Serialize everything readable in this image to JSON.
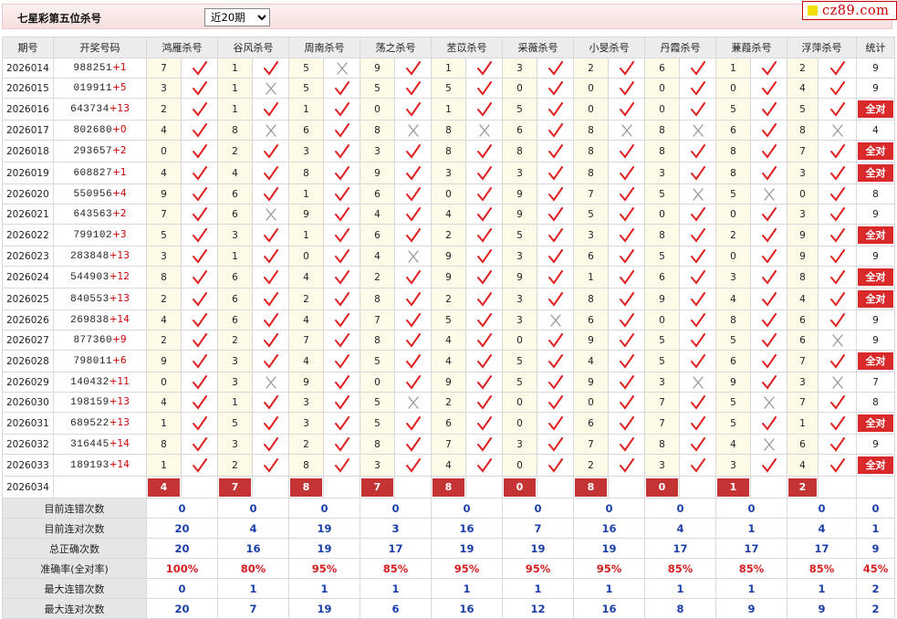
{
  "header": {
    "title": "七星彩第五位杀号",
    "period_selected": "近20期",
    "logo_text": "cz89.com"
  },
  "columns": [
    "期号",
    "开奖号码",
    "鸿雁杀号",
    "谷风杀号",
    "周南杀号",
    "荡之杀号",
    "苤苡杀号",
    "采薇杀号",
    "小旻杀号",
    "丹霞杀号",
    "蒹葭杀号",
    "浮萍杀号",
    "统计"
  ],
  "rows": [
    {
      "period": "2026014",
      "digits": "988251",
      "add": "+1",
      "picks": [
        {
          "v": "7",
          "ok": true
        },
        {
          "v": "1",
          "ok": true
        },
        {
          "v": "5",
          "ok": false
        },
        {
          "v": "9",
          "ok": true
        },
        {
          "v": "1",
          "ok": true
        },
        {
          "v": "3",
          "ok": true
        },
        {
          "v": "2",
          "ok": true
        },
        {
          "v": "6",
          "ok": true
        },
        {
          "v": "1",
          "ok": true
        },
        {
          "v": "2",
          "ok": true
        }
      ],
      "stat": "9"
    },
    {
      "period": "2026015",
      "digits": "019911",
      "add": "+5",
      "picks": [
        {
          "v": "3",
          "ok": true
        },
        {
          "v": "1",
          "ok": false
        },
        {
          "v": "5",
          "ok": true
        },
        {
          "v": "5",
          "ok": true
        },
        {
          "v": "5",
          "ok": true
        },
        {
          "v": "0",
          "ok": true
        },
        {
          "v": "0",
          "ok": true
        },
        {
          "v": "0",
          "ok": true
        },
        {
          "v": "0",
          "ok": true
        },
        {
          "v": "4",
          "ok": true
        }
      ],
      "stat": "9"
    },
    {
      "period": "2026016",
      "digits": "643734",
      "add": "+13",
      "picks": [
        {
          "v": "2",
          "ok": true
        },
        {
          "v": "1",
          "ok": true
        },
        {
          "v": "1",
          "ok": true
        },
        {
          "v": "0",
          "ok": true
        },
        {
          "v": "1",
          "ok": true
        },
        {
          "v": "5",
          "ok": true
        },
        {
          "v": "0",
          "ok": true
        },
        {
          "v": "0",
          "ok": true
        },
        {
          "v": "5",
          "ok": true
        },
        {
          "v": "5",
          "ok": true
        }
      ],
      "stat": "全对"
    },
    {
      "period": "2026017",
      "digits": "802680",
      "add": "+0",
      "picks": [
        {
          "v": "4",
          "ok": true
        },
        {
          "v": "8",
          "ok": false
        },
        {
          "v": "6",
          "ok": true
        },
        {
          "v": "8",
          "ok": false
        },
        {
          "v": "8",
          "ok": false
        },
        {
          "v": "6",
          "ok": true
        },
        {
          "v": "8",
          "ok": false
        },
        {
          "v": "8",
          "ok": false
        },
        {
          "v": "6",
          "ok": true
        },
        {
          "v": "8",
          "ok": false
        }
      ],
      "stat": "4"
    },
    {
      "period": "2026018",
      "digits": "293657",
      "add": "+2",
      "picks": [
        {
          "v": "0",
          "ok": true
        },
        {
          "v": "2",
          "ok": true
        },
        {
          "v": "3",
          "ok": true
        },
        {
          "v": "3",
          "ok": true
        },
        {
          "v": "8",
          "ok": true
        },
        {
          "v": "8",
          "ok": true
        },
        {
          "v": "8",
          "ok": true
        },
        {
          "v": "8",
          "ok": true
        },
        {
          "v": "8",
          "ok": true
        },
        {
          "v": "7",
          "ok": true
        }
      ],
      "stat": "全对"
    },
    {
      "period": "2026019",
      "digits": "608827",
      "add": "+1",
      "picks": [
        {
          "v": "4",
          "ok": true
        },
        {
          "v": "4",
          "ok": true
        },
        {
          "v": "8",
          "ok": true
        },
        {
          "v": "9",
          "ok": true
        },
        {
          "v": "3",
          "ok": true
        },
        {
          "v": "3",
          "ok": true
        },
        {
          "v": "8",
          "ok": true
        },
        {
          "v": "3",
          "ok": true
        },
        {
          "v": "8",
          "ok": true
        },
        {
          "v": "3",
          "ok": true
        }
      ],
      "stat": "全对"
    },
    {
      "period": "2026020",
      "digits": "550956",
      "add": "+4",
      "picks": [
        {
          "v": "9",
          "ok": true
        },
        {
          "v": "6",
          "ok": true
        },
        {
          "v": "1",
          "ok": true
        },
        {
          "v": "6",
          "ok": true
        },
        {
          "v": "0",
          "ok": true
        },
        {
          "v": "9",
          "ok": true
        },
        {
          "v": "7",
          "ok": true
        },
        {
          "v": "5",
          "ok": false
        },
        {
          "v": "5",
          "ok": false
        },
        {
          "v": "0",
          "ok": true
        }
      ],
      "stat": "8"
    },
    {
      "period": "2026021",
      "digits": "643563",
      "add": "+2",
      "picks": [
        {
          "v": "7",
          "ok": true
        },
        {
          "v": "6",
          "ok": false
        },
        {
          "v": "9",
          "ok": true
        },
        {
          "v": "4",
          "ok": true
        },
        {
          "v": "4",
          "ok": true
        },
        {
          "v": "9",
          "ok": true
        },
        {
          "v": "5",
          "ok": true
        },
        {
          "v": "0",
          "ok": true
        },
        {
          "v": "0",
          "ok": true
        },
        {
          "v": "3",
          "ok": true
        }
      ],
      "stat": "9"
    },
    {
      "period": "2026022",
      "digits": "799102",
      "add": "+3",
      "picks": [
        {
          "v": "5",
          "ok": true
        },
        {
          "v": "3",
          "ok": true
        },
        {
          "v": "1",
          "ok": true
        },
        {
          "v": "6",
          "ok": true
        },
        {
          "v": "2",
          "ok": true
        },
        {
          "v": "5",
          "ok": true
        },
        {
          "v": "3",
          "ok": true
        },
        {
          "v": "8",
          "ok": true
        },
        {
          "v": "2",
          "ok": true
        },
        {
          "v": "9",
          "ok": true
        }
      ],
      "stat": "全对"
    },
    {
      "period": "2026023",
      "digits": "283848",
      "add": "+13",
      "picks": [
        {
          "v": "3",
          "ok": true
        },
        {
          "v": "1",
          "ok": true
        },
        {
          "v": "0",
          "ok": true
        },
        {
          "v": "4",
          "ok": false
        },
        {
          "v": "9",
          "ok": true
        },
        {
          "v": "3",
          "ok": true
        },
        {
          "v": "6",
          "ok": true
        },
        {
          "v": "5",
          "ok": true
        },
        {
          "v": "0",
          "ok": true
        },
        {
          "v": "9",
          "ok": true
        }
      ],
      "stat": "9"
    },
    {
      "period": "2026024",
      "digits": "544903",
      "add": "+12",
      "picks": [
        {
          "v": "8",
          "ok": true
        },
        {
          "v": "6",
          "ok": true
        },
        {
          "v": "4",
          "ok": true
        },
        {
          "v": "2",
          "ok": true
        },
        {
          "v": "9",
          "ok": true
        },
        {
          "v": "9",
          "ok": true
        },
        {
          "v": "1",
          "ok": true
        },
        {
          "v": "6",
          "ok": true
        },
        {
          "v": "3",
          "ok": true
        },
        {
          "v": "8",
          "ok": true
        }
      ],
      "stat": "全对"
    },
    {
      "period": "2026025",
      "digits": "840553",
      "add": "+13",
      "picks": [
        {
          "v": "2",
          "ok": true
        },
        {
          "v": "6",
          "ok": true
        },
        {
          "v": "2",
          "ok": true
        },
        {
          "v": "8",
          "ok": true
        },
        {
          "v": "2",
          "ok": true
        },
        {
          "v": "3",
          "ok": true
        },
        {
          "v": "8",
          "ok": true
        },
        {
          "v": "9",
          "ok": true
        },
        {
          "v": "4",
          "ok": true
        },
        {
          "v": "4",
          "ok": true
        }
      ],
      "stat": "全对"
    },
    {
      "period": "2026026",
      "digits": "269838",
      "add": "+14",
      "picks": [
        {
          "v": "4",
          "ok": true
        },
        {
          "v": "6",
          "ok": true
        },
        {
          "v": "4",
          "ok": true
        },
        {
          "v": "7",
          "ok": true
        },
        {
          "v": "5",
          "ok": true
        },
        {
          "v": "3",
          "ok": false
        },
        {
          "v": "6",
          "ok": true
        },
        {
          "v": "0",
          "ok": true
        },
        {
          "v": "8",
          "ok": true
        },
        {
          "v": "6",
          "ok": true
        }
      ],
      "stat": "9"
    },
    {
      "period": "2026027",
      "digits": "877360",
      "add": "+9",
      "picks": [
        {
          "v": "2",
          "ok": true
        },
        {
          "v": "2",
          "ok": true
        },
        {
          "v": "7",
          "ok": true
        },
        {
          "v": "8",
          "ok": true
        },
        {
          "v": "4",
          "ok": true
        },
        {
          "v": "0",
          "ok": true
        },
        {
          "v": "9",
          "ok": true
        },
        {
          "v": "5",
          "ok": true
        },
        {
          "v": "5",
          "ok": true
        },
        {
          "v": "6",
          "ok": false
        }
      ],
      "stat": "9"
    },
    {
      "period": "2026028",
      "digits": "798011",
      "add": "+6",
      "picks": [
        {
          "v": "9",
          "ok": true
        },
        {
          "v": "3",
          "ok": true
        },
        {
          "v": "4",
          "ok": true
        },
        {
          "v": "5",
          "ok": true
        },
        {
          "v": "4",
          "ok": true
        },
        {
          "v": "5",
          "ok": true
        },
        {
          "v": "4",
          "ok": true
        },
        {
          "v": "5",
          "ok": true
        },
        {
          "v": "6",
          "ok": true
        },
        {
          "v": "7",
          "ok": true
        }
      ],
      "stat": "全对"
    },
    {
      "period": "2026029",
      "digits": "140432",
      "add": "+11",
      "picks": [
        {
          "v": "0",
          "ok": true
        },
        {
          "v": "3",
          "ok": false
        },
        {
          "v": "9",
          "ok": true
        },
        {
          "v": "0",
          "ok": true
        },
        {
          "v": "9",
          "ok": true
        },
        {
          "v": "5",
          "ok": true
        },
        {
          "v": "9",
          "ok": true
        },
        {
          "v": "3",
          "ok": false
        },
        {
          "v": "9",
          "ok": true
        },
        {
          "v": "3",
          "ok": false
        }
      ],
      "stat": "7"
    },
    {
      "period": "2026030",
      "digits": "198159",
      "add": "+13",
      "picks": [
        {
          "v": "4",
          "ok": true
        },
        {
          "v": "1",
          "ok": true
        },
        {
          "v": "3",
          "ok": true
        },
        {
          "v": "5",
          "ok": false
        },
        {
          "v": "2",
          "ok": true
        },
        {
          "v": "0",
          "ok": true
        },
        {
          "v": "0",
          "ok": true
        },
        {
          "v": "7",
          "ok": true
        },
        {
          "v": "5",
          "ok": false
        },
        {
          "v": "7",
          "ok": true
        }
      ],
      "stat": "8"
    },
    {
      "period": "2026031",
      "digits": "689522",
      "add": "+13",
      "picks": [
        {
          "v": "1",
          "ok": true
        },
        {
          "v": "5",
          "ok": true
        },
        {
          "v": "3",
          "ok": true
        },
        {
          "v": "5",
          "ok": true
        },
        {
          "v": "6",
          "ok": true
        },
        {
          "v": "0",
          "ok": true
        },
        {
          "v": "6",
          "ok": true
        },
        {
          "v": "7",
          "ok": true
        },
        {
          "v": "5",
          "ok": true
        },
        {
          "v": "1",
          "ok": true
        }
      ],
      "stat": "全对"
    },
    {
      "period": "2026032",
      "digits": "316445",
      "add": "+14",
      "picks": [
        {
          "v": "8",
          "ok": true
        },
        {
          "v": "3",
          "ok": true
        },
        {
          "v": "2",
          "ok": true
        },
        {
          "v": "8",
          "ok": true
        },
        {
          "v": "7",
          "ok": true
        },
        {
          "v": "3",
          "ok": true
        },
        {
          "v": "7",
          "ok": true
        },
        {
          "v": "8",
          "ok": true
        },
        {
          "v": "4",
          "ok": false
        },
        {
          "v": "6",
          "ok": true
        }
      ],
      "stat": "9"
    },
    {
      "period": "2026033",
      "digits": "189193",
      "add": "+14",
      "picks": [
        {
          "v": "1",
          "ok": true
        },
        {
          "v": "2",
          "ok": true
        },
        {
          "v": "8",
          "ok": true
        },
        {
          "v": "3",
          "ok": true
        },
        {
          "v": "4",
          "ok": true
        },
        {
          "v": "0",
          "ok": true
        },
        {
          "v": "2",
          "ok": true
        },
        {
          "v": "3",
          "ok": true
        },
        {
          "v": "3",
          "ok": true
        },
        {
          "v": "4",
          "ok": true
        }
      ],
      "stat": "全对"
    }
  ],
  "current": {
    "period": "2026034",
    "label": "当前期杀号",
    "picks": [
      "4",
      "7",
      "8",
      "7",
      "8",
      "0",
      "8",
      "0",
      "1",
      "2"
    ]
  },
  "stats": [
    {
      "label": "目前连错次数",
      "values": [
        "0",
        "0",
        "0",
        "0",
        "0",
        "0",
        "0",
        "0",
        "0",
        "0"
      ],
      "total": "0",
      "rate": false
    },
    {
      "label": "目前连对次数",
      "values": [
        "20",
        "4",
        "19",
        "3",
        "16",
        "7",
        "16",
        "4",
        "1",
        "4"
      ],
      "total": "1",
      "rate": false
    },
    {
      "label": "总正确次数",
      "values": [
        "20",
        "16",
        "19",
        "17",
        "19",
        "19",
        "19",
        "17",
        "17",
        "17"
      ],
      "total": "9",
      "rate": false
    },
    {
      "label": "准确率(全对率)",
      "values": [
        "100%",
        "80%",
        "95%",
        "85%",
        "95%",
        "95%",
        "95%",
        "85%",
        "85%",
        "85%"
      ],
      "total": "45%",
      "rate": true
    },
    {
      "label": "最大连错次数",
      "values": [
        "0",
        "1",
        "1",
        "1",
        "1",
        "1",
        "1",
        "1",
        "1",
        "1"
      ],
      "total": "2",
      "rate": false
    },
    {
      "label": "最大连对次数",
      "values": [
        "20",
        "7",
        "19",
        "6",
        "16",
        "12",
        "16",
        "8",
        "9",
        "9"
      ],
      "total": "2",
      "rate": false
    }
  ],
  "colors": {
    "check": "#e02020",
    "cross": "#999999",
    "badge": "#c53434",
    "stat_blue": "#1a3fa8",
    "stat_red": "#d42020"
  }
}
